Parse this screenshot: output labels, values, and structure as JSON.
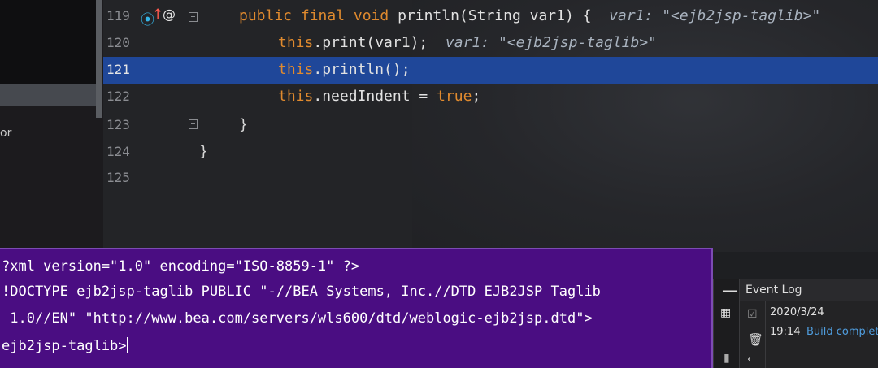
{
  "editor": {
    "lines": [
      {
        "num": "119",
        "kw1": "public final void ",
        "fn": "println(String var1) {",
        "hint": "  var1: \"<ejb2jsp-taglib>\""
      },
      {
        "num": "120",
        "kw1": "this",
        "fn": ".print(var1);",
        "hint": "  var1: \"<ejb2jsp-taglib>\""
      },
      {
        "num": "121",
        "kw1": "this",
        "fn": ".println();",
        "hint": ""
      },
      {
        "num": "122",
        "kw1": "this",
        "fn": ".needIndent = ",
        "kw2": "true",
        "tail": ";"
      },
      {
        "num": "123",
        "text": "}"
      },
      {
        "num": "124",
        "text": "}"
      },
      {
        "num": "125",
        "text": ""
      }
    ],
    "highlighted_line": "121",
    "gutter_icons": [
      "debug-breakpoint-icon",
      "override-up-arrow-icon",
      "annotation-at-icon"
    ]
  },
  "left_panel": {
    "partial_text": "or"
  },
  "popup": {
    "lines": [
      "?xml version=\"1.0\" encoding=\"ISO-8859-1\" ?>",
      "!DOCTYPE ejb2jsp-taglib PUBLIC \"-//BEA Systems, Inc.//DTD EJB2JSP Taglib",
      " 1.0//EN\" \"http://www.bea.com/servers/wls600/dtd/weblogic-ejb2jsp.dtd\">",
      "ejb2jsp-taglib>"
    ],
    "background": "#4a0d82"
  },
  "event_log": {
    "title": "Event Log",
    "date": "2020/3/24",
    "time": "19:14",
    "link_text": "Build complete"
  },
  "colors": {
    "keyword": "#e08a2e",
    "highlight": "#1f4799",
    "link": "#4f9dde"
  }
}
